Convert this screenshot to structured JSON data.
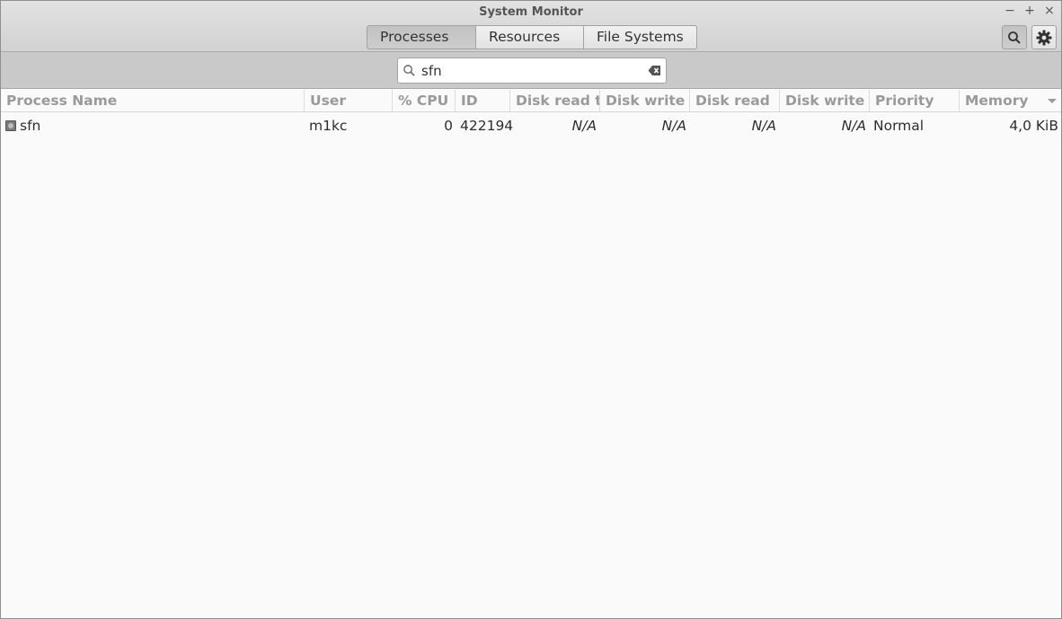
{
  "window": {
    "title": "System Monitor",
    "min_glyph": "−",
    "max_glyph": "+",
    "close_glyph": "×"
  },
  "tabs": [
    {
      "label": "Processes",
      "active": true
    },
    {
      "label": "Resources",
      "active": false
    },
    {
      "label": "File Systems",
      "active": false
    }
  ],
  "header_buttons": {
    "search_icon": "search-icon",
    "settings_icon": "gear-icon"
  },
  "search": {
    "value": "sfn"
  },
  "table": {
    "columns": [
      "Process Name",
      "User",
      "% CPU",
      "ID",
      "Disk read to",
      "Disk write t",
      "Disk read",
      "Disk write",
      "Priority",
      "Memory"
    ],
    "sorted_column": "Memory",
    "rows": [
      {
        "name": "sfn",
        "user": "m1kc",
        "cpu": "0",
        "id": "422194",
        "disk_read_total": "N/A",
        "disk_write_total": "N/A",
        "disk_read": "N/A",
        "disk_write": "N/A",
        "priority": "Normal",
        "memory": "4,0 KiB"
      }
    ]
  },
  "colors": {
    "header_bg": "#d9d9d9",
    "searchbar_bg": "#c9c9c9",
    "content_bg": "#fafafa",
    "column_header_text": "#9a9a9a"
  }
}
